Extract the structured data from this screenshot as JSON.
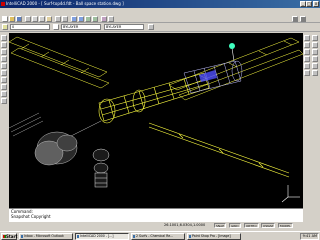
{
  "window": {
    "title": "IntelliCAD 2000 - [ Surf-top4d.fdt - Ball space station.dwg ]",
    "min": "_",
    "max": "□",
    "close": "x"
  },
  "menu": [
    "File",
    "Edit",
    "View",
    "Insert",
    "Format",
    "Tools",
    "Draw",
    "Dimensions",
    "Modify",
    "Settings",
    "Window",
    "Help"
  ],
  "toolbar": {
    "layer": "0",
    "linetype": "BYLAYER",
    "style": "BYLAYER"
  },
  "command": {
    "line1": "Command:",
    "line2": "Snapshot Copyright"
  },
  "status": {
    "coords": "26.1001,6.0304,1.0000",
    "indicators": [
      "SNAP",
      "GRID",
      "ORTHO",
      "OSNAP",
      "MODEL"
    ]
  },
  "taskbar": {
    "start": "Start",
    "tasks": [
      "Inbox - Microsoft Outlook",
      "IntelliCAD 2000 - [...]",
      "2 Surfs - Chemical Re...",
      "Paint Shop Pro - [Image]"
    ],
    "time": "9:41 AM"
  },
  "colors": {
    "wire": "#ffff40",
    "blue": "#5050ff",
    "gray": "#c0c0c0",
    "cyan": "#40ffc0"
  }
}
